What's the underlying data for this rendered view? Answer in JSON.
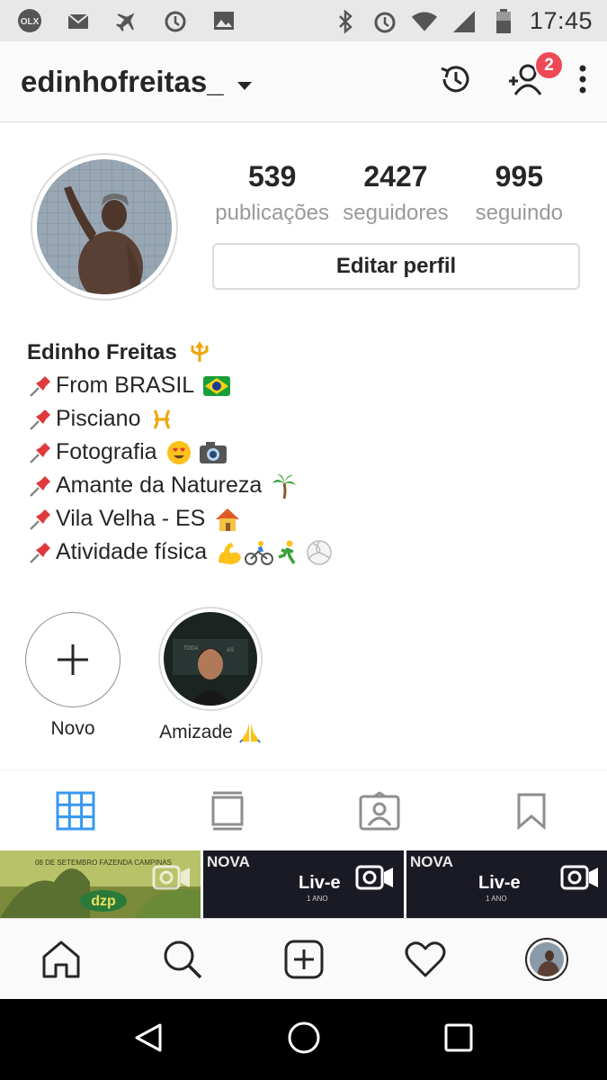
{
  "status_bar": {
    "time": "17:45",
    "left_icons": [
      "olx-icon",
      "mail-heart-icon",
      "airplane-icon",
      "alarm-icon",
      "image-icon"
    ],
    "right_icons": [
      "bluetooth-icon",
      "alarm-icon",
      "wifi-icon",
      "signal-icon",
      "battery-icon"
    ]
  },
  "header": {
    "username": "edinhofreitas_",
    "notification_count": "2"
  },
  "profile": {
    "stats": [
      {
        "value": "539",
        "label": "publicações"
      },
      {
        "value": "2427",
        "label": "seguidores"
      },
      {
        "value": "995",
        "label": "seguindo"
      }
    ],
    "edit_button": "Editar perfil",
    "name": "Edinho Freitas",
    "bio_lines": [
      "From BRASIL",
      "Pisciano",
      "Fotografia",
      "Amante da Natureza",
      "Vila Velha - ES",
      "Atividade física"
    ]
  },
  "highlights": [
    {
      "label": "Novo"
    },
    {
      "label": "Amizade"
    }
  ],
  "grid": [
    {
      "title": "08 DE SETEMBRO FAZENDA CAMPINAS",
      "logo": "dzp"
    },
    {
      "title": "NOVA",
      "logo": "Liv-e",
      "sub": "1 ANO"
    },
    {
      "title": "NOVA",
      "logo": "Liv-e",
      "sub": "1 ANO"
    }
  ],
  "colors": {
    "accent": "#3897f0",
    "badge": "#ed4956",
    "text": "#262626",
    "muted": "#999999"
  }
}
